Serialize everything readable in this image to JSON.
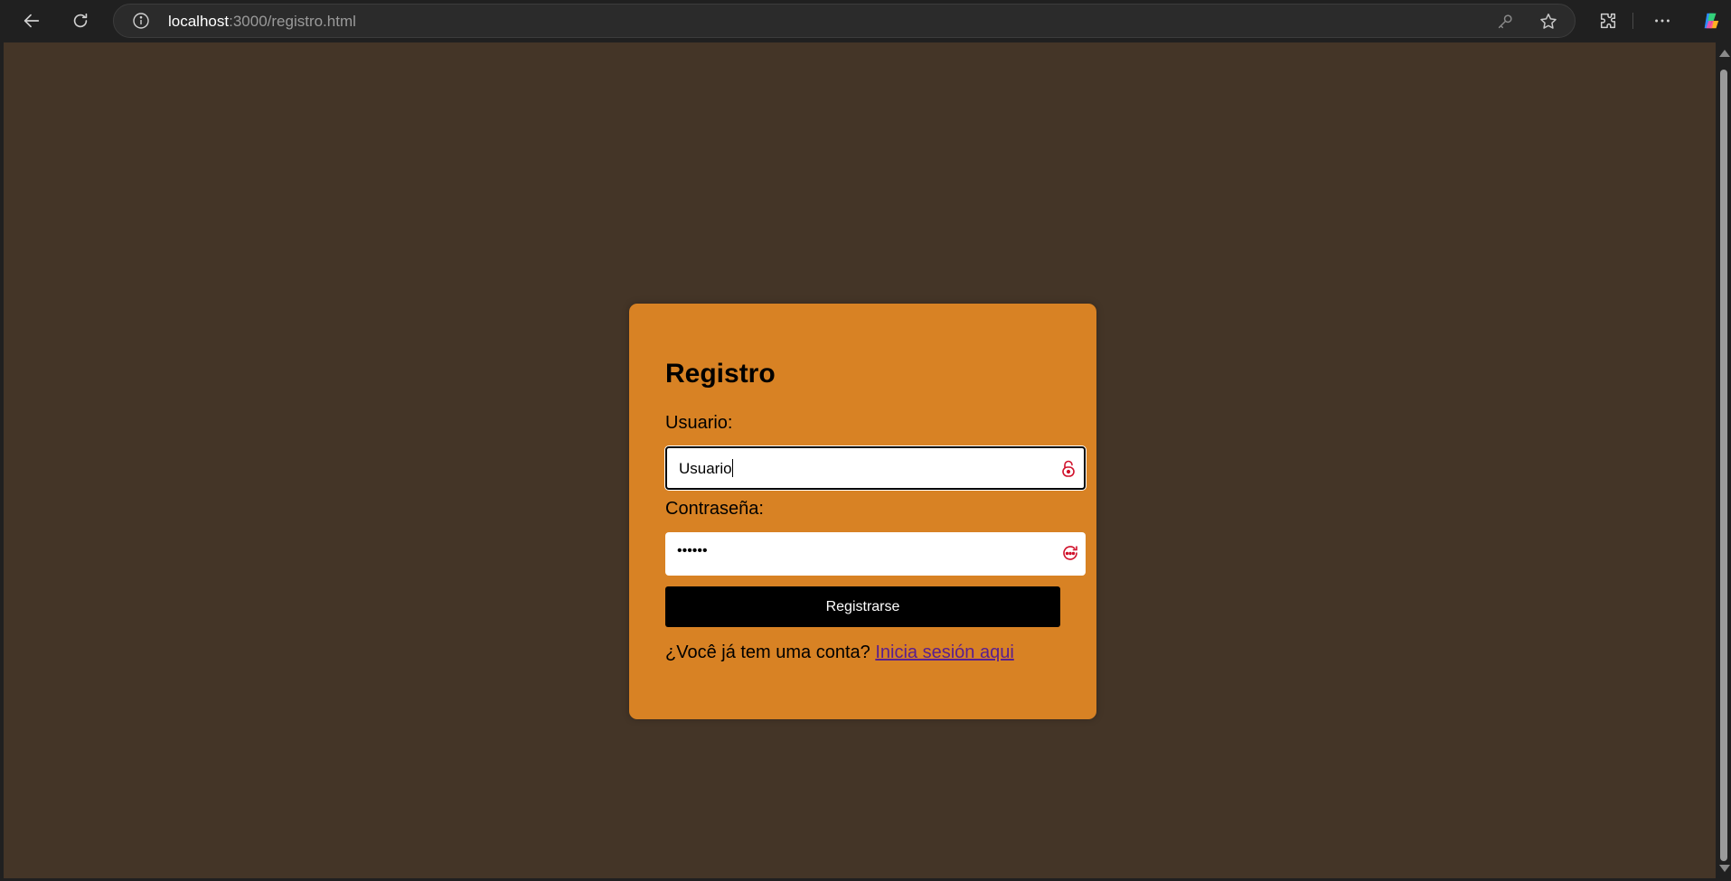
{
  "browser": {
    "url_host": "localhost",
    "url_path": ":3000/registro.html",
    "icons": {
      "back": "arrow-left-icon",
      "reload": "reload-icon",
      "info": "info-icon",
      "password_key": "key-icon",
      "favorite": "star-icon",
      "extensions": "puzzle-icon",
      "menu": "more-icon",
      "copilot": "copilot-icon"
    }
  },
  "page": {
    "background": "#443527",
    "card_color": "#d88224"
  },
  "form": {
    "title": "Registro",
    "username": {
      "label": "Usuario:",
      "value": "Usuario"
    },
    "password": {
      "label": "Contraseña:",
      "value": "••••••"
    },
    "submit_label": "Registrarse",
    "footer_text": "¿Você já tem uma conta? ",
    "login_link_label": "Inicia sesión aqui"
  }
}
